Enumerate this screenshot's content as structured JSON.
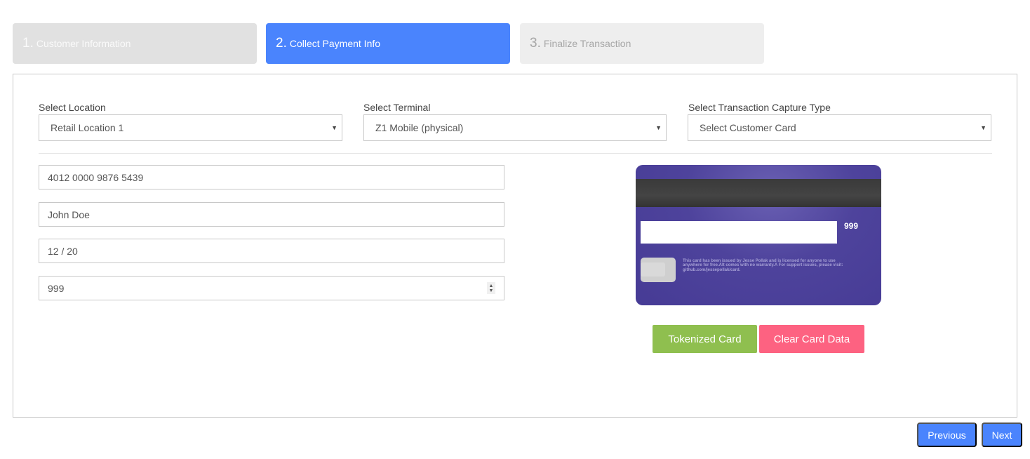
{
  "steps": [
    {
      "number": "1.",
      "label": "Customer Information",
      "state": "completed"
    },
    {
      "number": "2.",
      "label": "Collect Payment Info",
      "state": "active"
    },
    {
      "number": "3.",
      "label": "Finalize Transaction",
      "state": "upcoming"
    }
  ],
  "selects": {
    "location": {
      "label": "Select Location",
      "value": "Retail Location 1"
    },
    "terminal": {
      "label": "Select Terminal",
      "value": "Z1 Mobile (physical)"
    },
    "capture_type": {
      "label": "Select Transaction Capture Type",
      "value": "Select Customer Card"
    }
  },
  "caret_glyph": "▼",
  "inputs": {
    "card_number": "4012 0000 9876 5439",
    "name": "John Doe",
    "expiry": "12 / 20",
    "cvc": "999"
  },
  "spinner": {
    "up": "▲",
    "down": "▼"
  },
  "card_preview": {
    "cvc": "999",
    "legal_text": "This card has been issued by Jesse Pollak and is licensed for anyone to use anywhere for free.Alt comes with no warranty.A For support issues, please visit: github.com/jessepollak/card."
  },
  "buttons": {
    "tokenized": "Tokenized Card",
    "clear": "Clear Card Data",
    "previous": "Previous",
    "next": "Next"
  },
  "colors": {
    "accent": "#4a84fd",
    "success": "#8fbf4f",
    "danger": "#fd6281",
    "card": "#4e439c"
  }
}
